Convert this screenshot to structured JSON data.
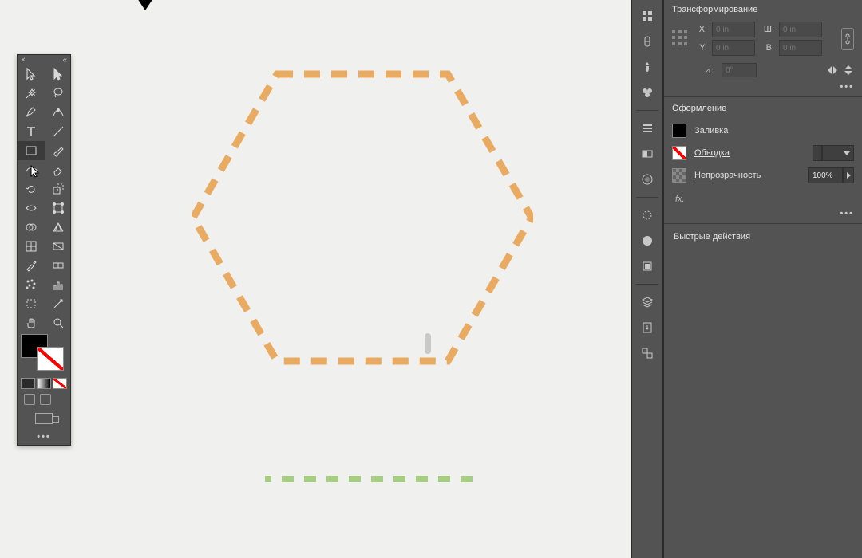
{
  "panels": {
    "transform_title": "Трансформирование",
    "appearance_title": "Оформление",
    "quick_actions_title": "Быстрые действия"
  },
  "transform": {
    "x_label": "X:",
    "y_label": "Y:",
    "w_label": "Ш:",
    "h_label": "В:",
    "x_value": "0 in",
    "y_value": "0 in",
    "w_value": "0 in",
    "h_value": "0 in",
    "angle_label": "⊿:",
    "angle_value": "0°"
  },
  "appearance": {
    "fill_label": "Заливка",
    "stroke_label": "Обводка",
    "opacity_label": "Непрозрачность",
    "opacity_value": "100%",
    "fx_label": "fx."
  },
  "toolbar": {
    "close": "×",
    "collapse": "«"
  },
  "colors": {
    "panel_bg": "#535353",
    "hex_stroke": "#e9aa61",
    "green_stroke": "#a7cf84",
    "canvas": "#f0f0ee"
  }
}
